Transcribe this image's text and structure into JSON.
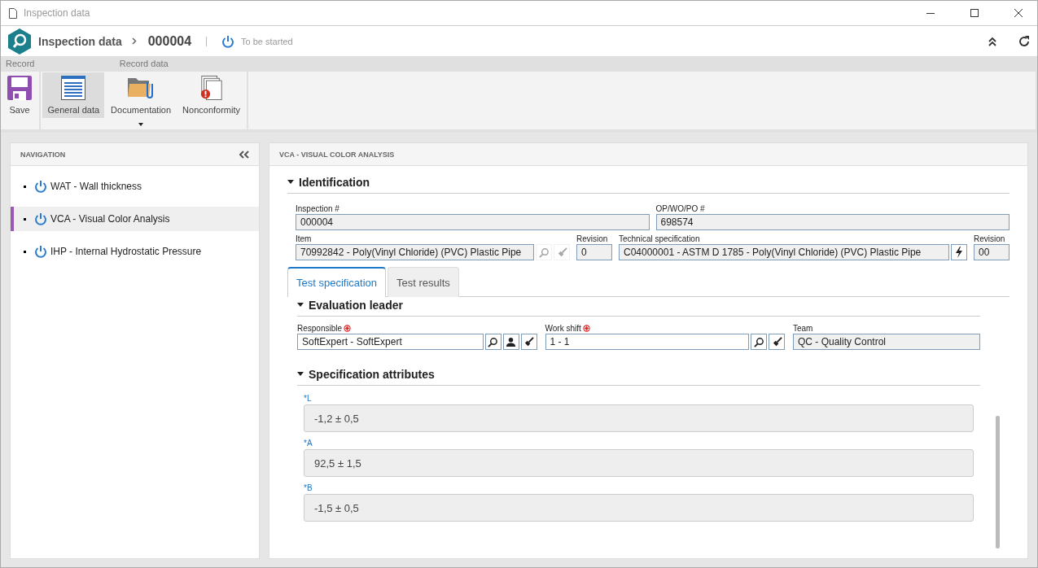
{
  "window": {
    "title": "Inspection data"
  },
  "header": {
    "module": "Inspection data",
    "record": "000004",
    "status": "To be started"
  },
  "ribbon": {
    "groups": [
      {
        "title": "Record",
        "buttons": [
          {
            "kind": "save",
            "label": "Save",
            "selected": false,
            "dropdown": false
          }
        ]
      },
      {
        "title": "Record data",
        "buttons": [
          {
            "kind": "general",
            "label": "General data",
            "selected": true,
            "dropdown": false
          },
          {
            "kind": "docs",
            "label": "Documentation",
            "selected": false,
            "dropdown": true
          },
          {
            "kind": "nonconf",
            "label": "Nonconformity",
            "selected": false,
            "dropdown": false
          }
        ]
      }
    ]
  },
  "navigation": {
    "title": "NAVIGATION",
    "items": [
      {
        "label": "WAT - Wall thickness",
        "selected": false
      },
      {
        "label": "VCA - Visual Color Analysis",
        "selected": true
      },
      {
        "label": "IHP - Internal Hydrostatic Pressure",
        "selected": false
      }
    ]
  },
  "panel": {
    "title": "VCA - VISUAL COLOR ANALYSIS",
    "identification": {
      "title": "Identification",
      "inspection": {
        "label": "Inspection #",
        "value": "000004"
      },
      "order": {
        "label": "OP/WO/PO #",
        "value": "698574"
      },
      "item": {
        "label": "Item",
        "value": "70992842 - Poly(Vinyl Chloride) (PVC) Plastic Pipe"
      },
      "item_revision": {
        "label": "Revision",
        "value": "0"
      },
      "spec": {
        "label": "Technical specification",
        "value": "C04000001 - ASTM D 1785 - Poly(Vinyl Chloride) (PVC) Plastic Pipe"
      },
      "spec_revision": {
        "label": "Revision",
        "value": "00"
      }
    },
    "tabs": [
      {
        "label": "Test specification",
        "selected": true
      },
      {
        "label": "Test results",
        "selected": false
      }
    ],
    "evaluation": {
      "title": "Evaluation leader",
      "responsible": {
        "label": "Responsible",
        "value": "SoftExpert - SoftExpert"
      },
      "shift": {
        "label": "Work shift",
        "value": "1 - 1"
      },
      "team": {
        "label": "Team",
        "value": "QC - Quality Control"
      }
    },
    "attributes": {
      "title": "Specification attributes",
      "items": [
        {
          "label": "*L",
          "value": "-1,2 ± 0,5"
        },
        {
          "label": "*A",
          "value": "92,5 ± 1,5"
        },
        {
          "label": "*B",
          "value": "-1,5 ± 0,5"
        }
      ]
    }
  }
}
